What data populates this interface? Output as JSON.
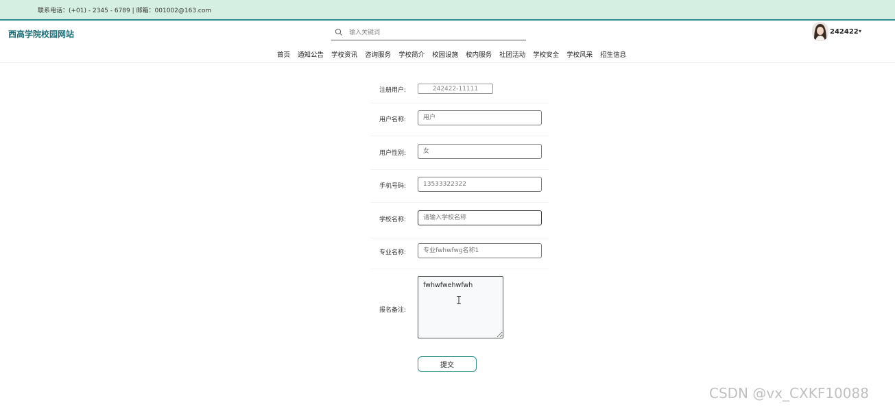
{
  "topbar": {
    "contact": "联系电话：(+01) - 2345 - 6789 | 邮箱：001002@163.com"
  },
  "header": {
    "logo": "西高学院校园网站",
    "search_placeholder": "输入关键词",
    "username": "242422",
    "caret": "▾"
  },
  "nav": [
    "首页",
    "通知公告",
    "学校资讯",
    "咨询服务",
    "学校简介",
    "校园设施",
    "校内服务",
    "社团活动",
    "学校安全",
    "学校风采",
    "招生信息"
  ],
  "form": {
    "fields": [
      {
        "label": "注册用户:",
        "value": "242422-11111"
      },
      {
        "label": "用户名称:",
        "placeholder": "用户"
      },
      {
        "label": "用户性别:",
        "placeholder": "女"
      },
      {
        "label": "手机号码:",
        "placeholder": "13533322322"
      },
      {
        "label": "学校名称:",
        "placeholder": "请输入学校名称"
      },
      {
        "label": "专业名称:",
        "placeholder": "专业fwhwfwg名称1"
      }
    ],
    "remark_label": "报名备注:",
    "remark_value": "fwhwfwehwfwh",
    "submit_label": "提交"
  },
  "watermark": "CSDN @vx_CXKF10088"
}
